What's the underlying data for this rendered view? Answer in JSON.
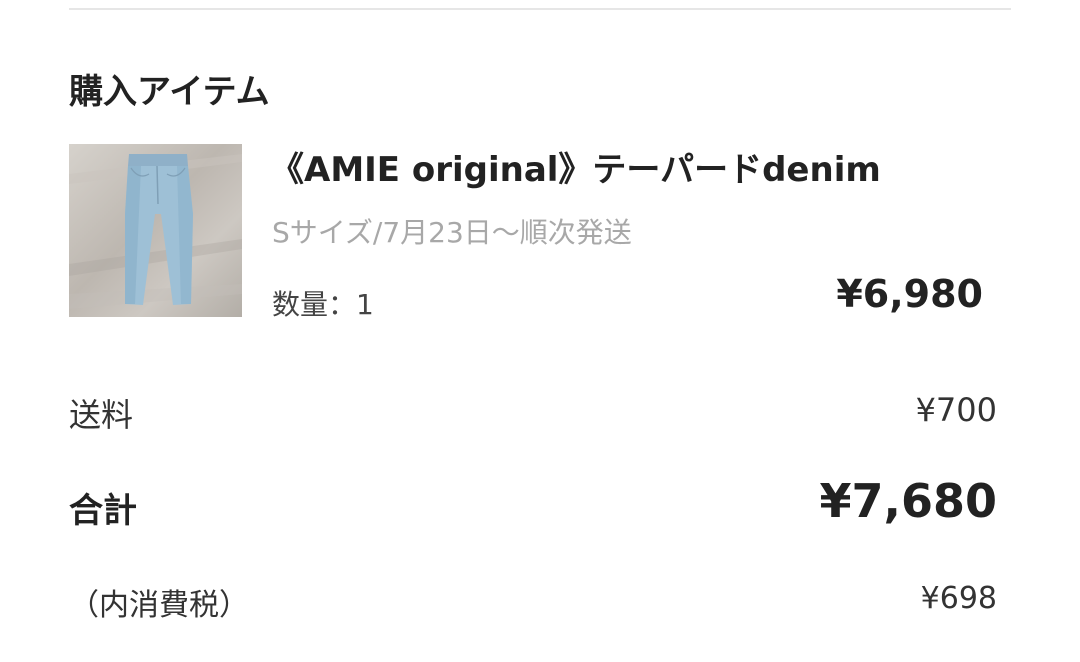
{
  "section": {
    "heading": "購入アイテム"
  },
  "item": {
    "name": "《AMIE original》テーパードdenim",
    "variant": "Sサイズ/7月23日～順次発送",
    "quantity": "数量：1",
    "price": "¥6,980",
    "image_icon": "jeans-product-photo"
  },
  "summary": {
    "shipping_label": "送料",
    "shipping_value": "¥700",
    "total_label": "合計",
    "total_value": "¥7,680",
    "tax_label": "（内消費税）",
    "tax_value": "¥698"
  }
}
